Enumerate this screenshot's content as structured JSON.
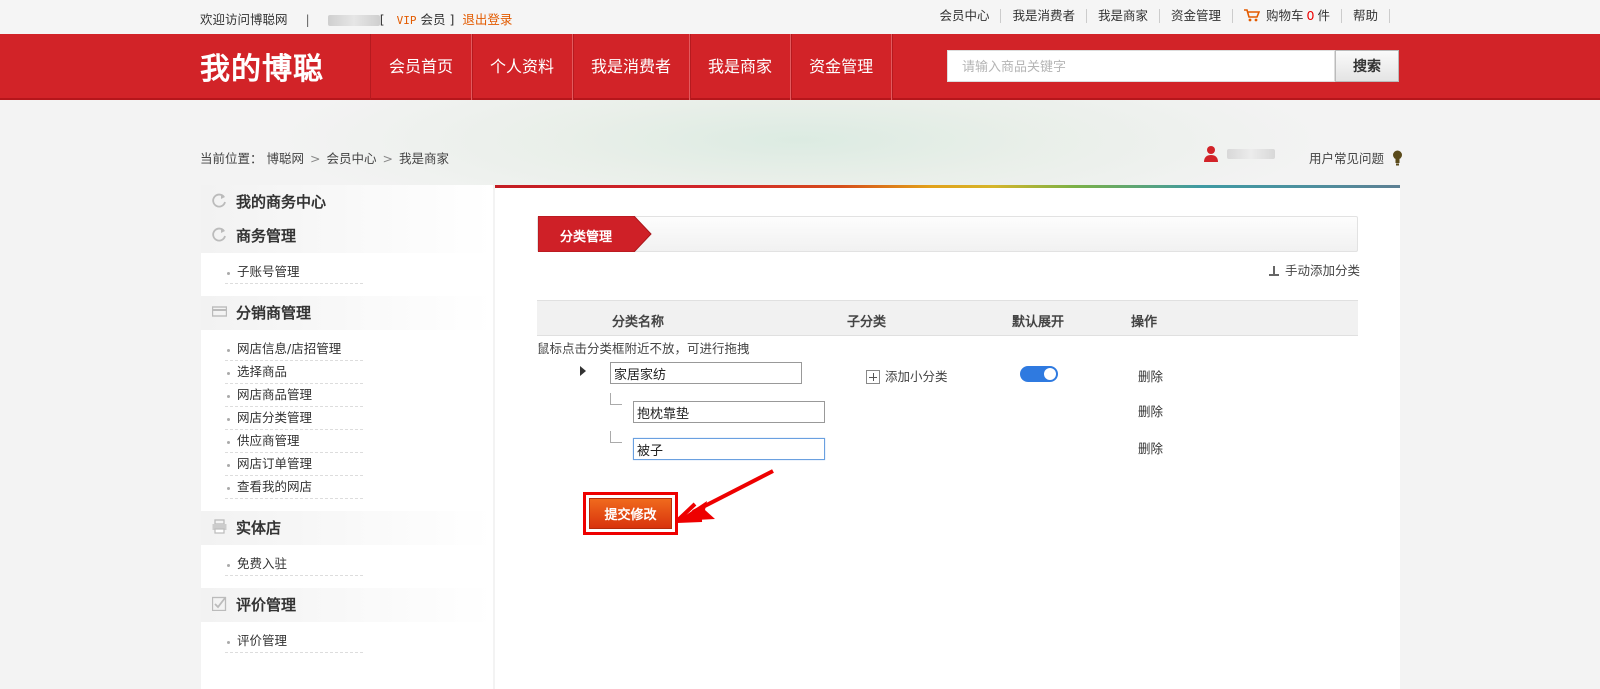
{
  "topbar": {
    "welcome": "欢迎访问博聪网",
    "separator": "|",
    "bracket_open": "[",
    "vip": "VIP",
    "member": "会员",
    "bracket_close": "]",
    "logout": "退出登录",
    "links": [
      "会员中心",
      "我是消费者",
      "我是商家",
      "资金管理"
    ],
    "cart_label": "购物车",
    "cart_count": "0",
    "cart_unit": "件",
    "help": "帮助"
  },
  "header": {
    "logo": "我的博聪",
    "nav": [
      "会员首页",
      "个人资料",
      "我是消费者",
      "我是商家",
      "资金管理"
    ],
    "search_placeholder": "请输入商品关键字",
    "search_button": "搜索"
  },
  "breadcrumb": {
    "prefix": "当前位置：",
    "items": [
      "博聪网",
      "会员中心",
      "我是商家"
    ],
    "arrow": ">"
  },
  "user": {
    "faq": "用户常见问题"
  },
  "sidebar": {
    "sections": [
      {
        "title": "我的商务中心",
        "icon": "refresh-icon",
        "items": []
      },
      {
        "title": "商务管理",
        "icon": "refresh-icon",
        "items": [
          "子账号管理"
        ]
      },
      {
        "title": "分销商管理",
        "icon": "card-icon",
        "items": [
          "网店信息/店招管理",
          "选择商品",
          "网店商品管理",
          "网店分类管理",
          "供应商管理",
          "网店订单管理",
          "查看我的网店"
        ]
      },
      {
        "title": "实体店",
        "icon": "printer-icon",
        "items": [
          "免费入驻"
        ]
      },
      {
        "title": "评价管理",
        "icon": "checkbox-icon",
        "items": [
          "评价管理"
        ]
      }
    ]
  },
  "content": {
    "tab": "分类管理",
    "add_category": "手动添加分类",
    "columns": [
      "分类名称",
      "子分类",
      "默认展开",
      "操作"
    ],
    "hint": "鼠标点击分类框附近不放，可进行拖拽",
    "category": {
      "name": "家居家纺",
      "add_sub": "添加小分类",
      "expanded": true,
      "delete": "删除",
      "children": [
        {
          "name": "抱枕靠垫",
          "delete": "删除"
        },
        {
          "name": "被子",
          "delete": "删除"
        }
      ]
    },
    "submit": "提交修改"
  },
  "colors": {
    "brand_red": "#d22328",
    "accent_orange": "#e35b00",
    "toggle_blue": "#2f7ae0",
    "highlight_red": "#ee0000"
  }
}
